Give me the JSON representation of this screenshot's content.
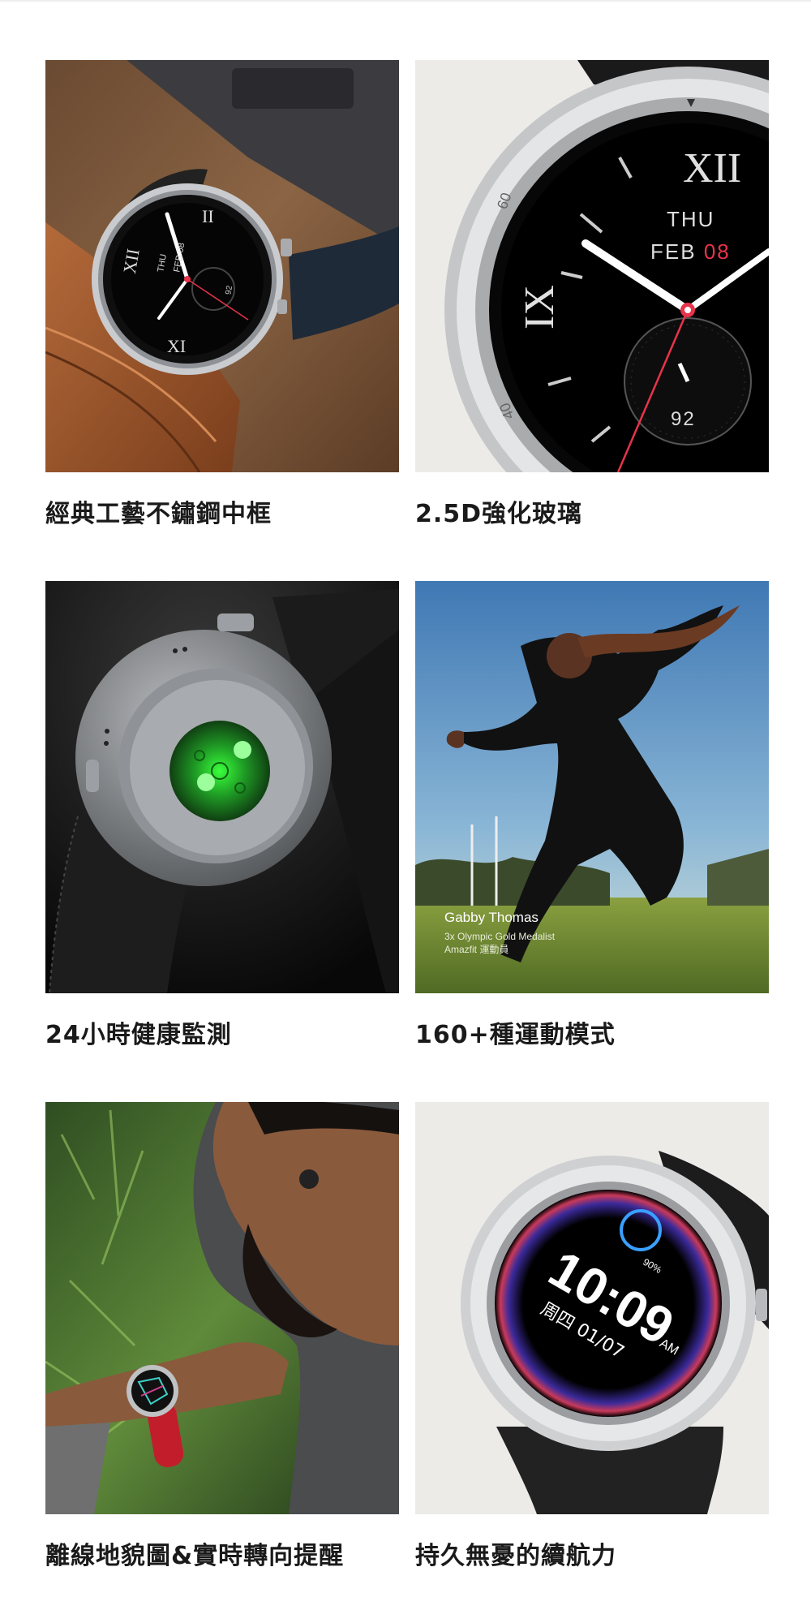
{
  "features": [
    {
      "caption": "經典工藝不鏽鋼中框",
      "watch": {
        "day": "THU",
        "date": "FEB 08",
        "sub": "92"
      }
    },
    {
      "caption": "2.5D強化玻璃",
      "watch": {
        "day": "THU",
        "month": "FEB",
        "daynum": "08",
        "sub": "92",
        "bezel_60": "60",
        "bezel_40": "40"
      }
    },
    {
      "caption": "24小時健康監測"
    },
    {
      "caption": "160+種運動模式",
      "athlete": {
        "name": "Gabby Thomas",
        "title": "3x Olympic Gold Medalist",
        "role": "Amazfit 運動員"
      }
    },
    {
      "caption": "離線地貌圖&實時轉向提醒"
    },
    {
      "caption": "持久無憂的續航力",
      "watch": {
        "time": "10:09",
        "ampm": "AM",
        "date": "周四 01/07",
        "battery": "90%"
      }
    }
  ],
  "colors": {
    "accent": "#e8334a",
    "caption": "#1a1a1a",
    "sensor_green": "#39ff3a"
  }
}
